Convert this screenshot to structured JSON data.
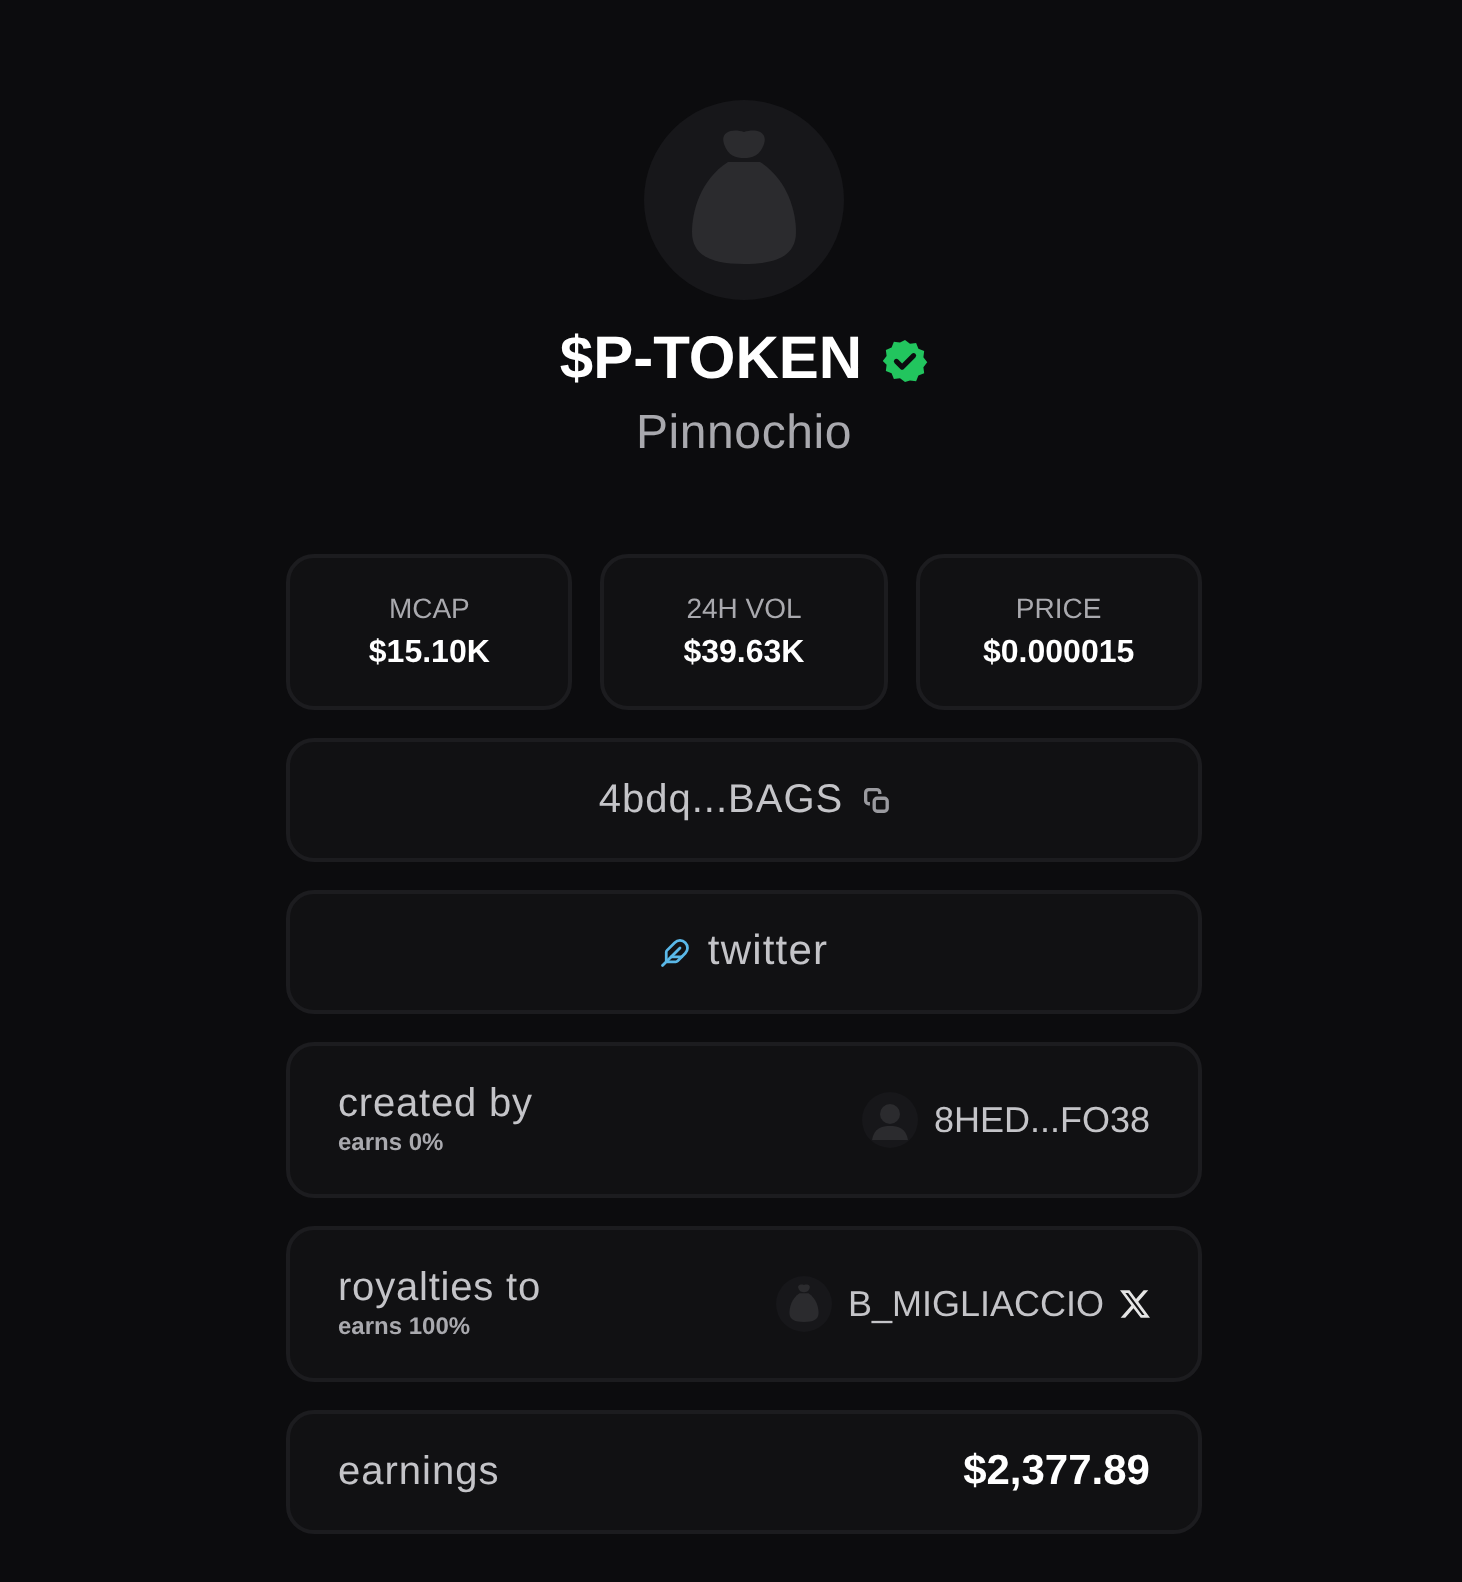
{
  "token": {
    "symbol": "$P-TOKEN",
    "verified": true,
    "name": "Pinnochio"
  },
  "stats": [
    {
      "label": "MCAP",
      "value": "$15.10K"
    },
    {
      "label": "24H VOL",
      "value": "$39.63K"
    },
    {
      "label": "PRICE",
      "value": "$0.000015"
    }
  ],
  "address": {
    "text": "4bdq...BAGS"
  },
  "links": [
    {
      "label": "twitter"
    }
  ],
  "people": [
    {
      "label": "created by",
      "earns": "earns 0%",
      "avatar": {
        "kind": "person"
      },
      "account": "8HED...FO38"
    },
    {
      "label": "royalties to",
      "earns": "earns 100%",
      "avatar": {
        "kind": "bag"
      },
      "account": "B_MIGLIACCIO",
      "social": {
        "kind": "x"
      }
    }
  ],
  "earnings": {
    "label": "earnings",
    "value": "$2,377.89"
  }
}
